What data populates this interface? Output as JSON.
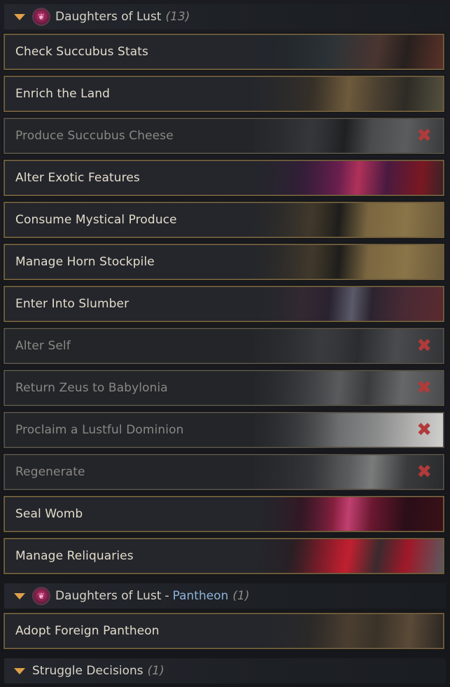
{
  "groups": [
    {
      "title": "Daughters of Lust",
      "count": "(13)"
    },
    {
      "title": "Daughters of Lust",
      "separator": "-",
      "subtitle": "Pantheon",
      "count": "(1)"
    },
    {
      "title": "Struggle Decisions",
      "count": "(1)"
    }
  ],
  "decisions": [
    {
      "label": "Check Succubus Stats",
      "enabled": true
    },
    {
      "label": "Enrich the Land",
      "enabled": true
    },
    {
      "label": "Produce Succubus Cheese",
      "enabled": false
    },
    {
      "label": "Alter Exotic Features",
      "enabled": true
    },
    {
      "label": "Consume Mystical Produce",
      "enabled": true
    },
    {
      "label": "Manage Horn Stockpile",
      "enabled": true
    },
    {
      "label": "Enter Into Slumber",
      "enabled": true
    },
    {
      "label": "Alter Self",
      "enabled": false
    },
    {
      "label": "Return Zeus to Babylonia",
      "enabled": false
    },
    {
      "label": "Proclaim a Lustful Dominion",
      "enabled": false
    },
    {
      "label": "Regenerate",
      "enabled": false
    },
    {
      "label": "Seal Womb",
      "enabled": true
    },
    {
      "label": "Manage Reliquaries",
      "enabled": true
    }
  ],
  "pantheon_decisions": [
    {
      "label": "Adopt Foreign Pantheon",
      "enabled": true
    }
  ],
  "icons": {
    "collapse": "chevron-down-icon",
    "emblem": "daughters-of-lust-emblem-icon",
    "unavailable": "close-icon",
    "unavailable_glyph": "✖"
  },
  "colors": {
    "row_border": "#6b5a3b",
    "text": "#e4dccb",
    "disabled_text": "#8a8884",
    "arrow": "#e0a04a",
    "pantheon": "#8fb3d9",
    "unavailable": "#b23a3a"
  }
}
